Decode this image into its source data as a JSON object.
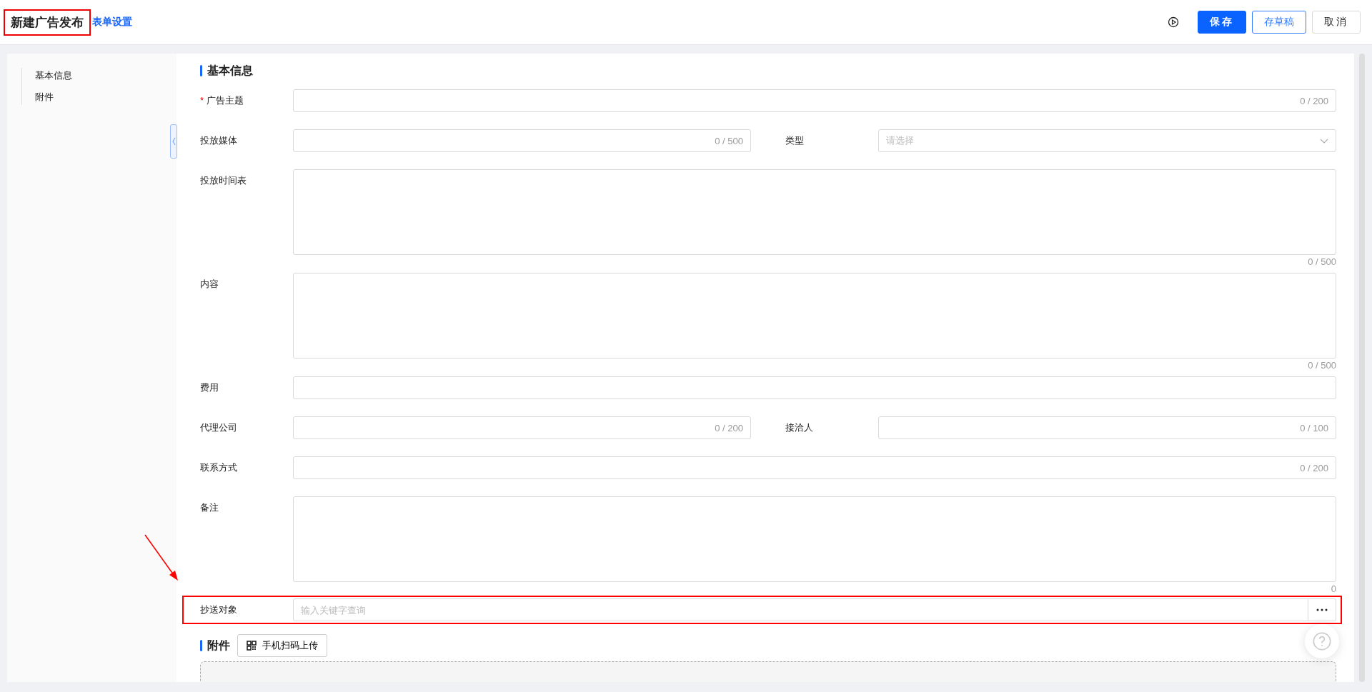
{
  "header": {
    "title": "新建广告发布",
    "title_highlighted": true,
    "settings_link": "表单设置",
    "buttons": [
      {
        "label": "保存",
        "kind": "primary"
      },
      {
        "label": "存草稿",
        "kind": "outline"
      },
      {
        "label": "取消",
        "kind": "default"
      }
    ]
  },
  "sidebar": {
    "items": [
      {
        "label": "基本信息"
      },
      {
        "label": "附件"
      }
    ]
  },
  "sections": [
    {
      "title": "基本信息",
      "rows": [
        [
          {
            "kind": "text",
            "label": "广告主题",
            "required_mark": "*",
            "counter": "0 / 200"
          }
        ],
        [
          {
            "kind": "text",
            "label": "投放媒体",
            "counter": "0 / 500"
          },
          {
            "kind": "select",
            "label": "类型",
            "placeholder": "请选择"
          }
        ],
        [
          {
            "kind": "textarea",
            "label": "投放时间表",
            "counter": "0 / 500"
          }
        ],
        [
          {
            "kind": "textarea",
            "label": "内容",
            "counter": "0 / 500"
          }
        ],
        [
          {
            "kind": "text",
            "label": "费用"
          }
        ],
        [
          {
            "kind": "text",
            "label": "代理公司",
            "counter": "0 / 200"
          },
          {
            "kind": "text",
            "label": "接洽人",
            "counter": "0 / 100"
          }
        ],
        [
          {
            "kind": "text",
            "label": "联系方式",
            "counter": "0 / 200"
          }
        ],
        [
          {
            "kind": "textarea",
            "label": "备注",
            "counter": "0"
          }
        ],
        [
          {
            "kind": "picker",
            "label": "抄送对象",
            "placeholder": "输入关键字查询",
            "highlighted": true
          }
        ]
      ]
    },
    {
      "title": "附件",
      "action": "手机扫码上传",
      "rows": [
        [
          {
            "kind": "dropzone"
          }
        ]
      ]
    }
  ]
}
